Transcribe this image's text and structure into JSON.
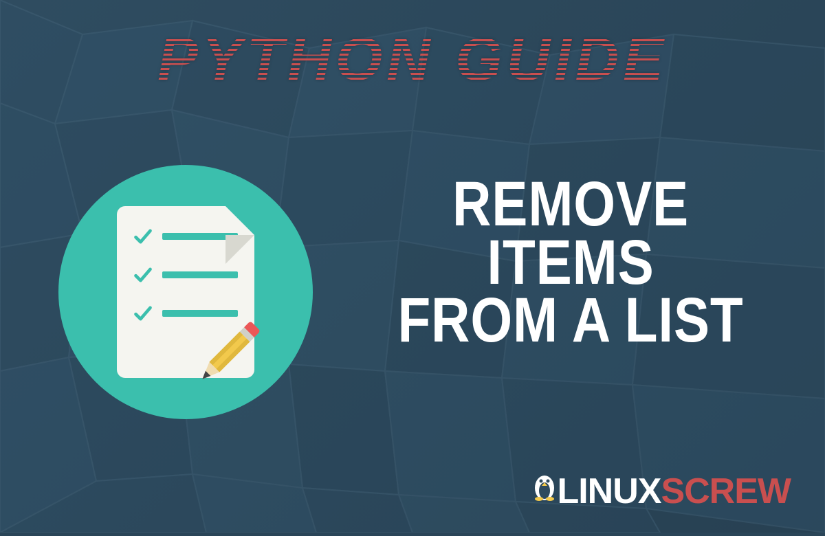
{
  "header": {
    "title": "PYTHON GUIDE"
  },
  "main": {
    "line1": "REMOVE ITEMS",
    "line2": "FROM A LIST"
  },
  "brand": {
    "part1": "LINUX",
    "part2": "SCREW"
  },
  "icon": {
    "name": "checklist-pencil"
  },
  "colors": {
    "accent_teal": "#3bbfad",
    "accent_red": "#c94f4f",
    "bg": "#2d4a5e",
    "white": "#ffffff",
    "pencil_body": "#f2c94c",
    "pencil_eraser": "#eb5757"
  }
}
